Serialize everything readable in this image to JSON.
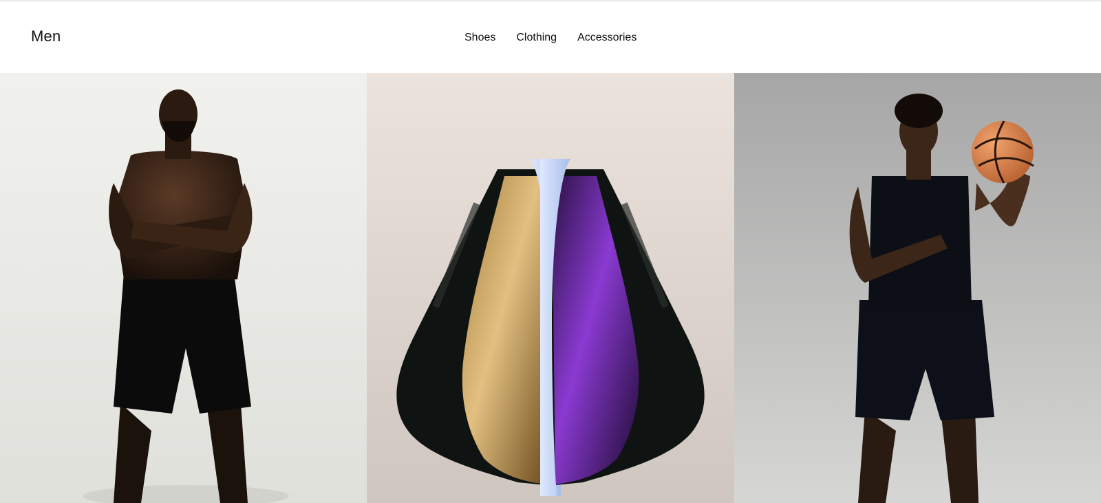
{
  "header": {
    "title": "Men",
    "nav": [
      {
        "label": "Shoes"
      },
      {
        "label": "Clothing"
      },
      {
        "label": "Accessories"
      }
    ]
  },
  "gallery": {
    "tiles": [
      {
        "name": "athlete-arms-crossed",
        "colors": {
          "bg1": "#f2f2ee",
          "bg2": "#e1e1dc"
        }
      },
      {
        "name": "shoes-gold-purple",
        "colors": {
          "bg1": "#e9e0d8",
          "bg2": "#cfc5bd"
        }
      },
      {
        "name": "athlete-holding-basketball",
        "colors": {
          "bg1": "#a9a9a9",
          "bg2": "#d7d7d5"
        }
      }
    ]
  }
}
